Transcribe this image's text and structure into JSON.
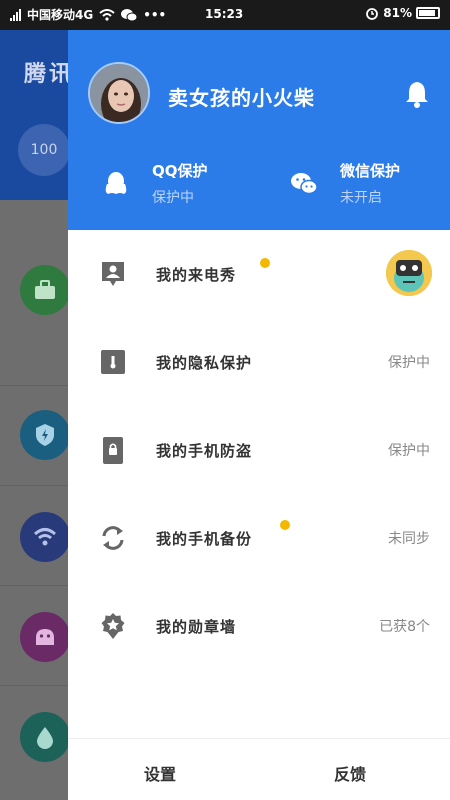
{
  "status_bar": {
    "carrier": "中国移动4G",
    "dots": "•••",
    "time": "15:23",
    "battery": "81%"
  },
  "background_app": {
    "title": "腾讯",
    "score": "100"
  },
  "drawer": {
    "user": {
      "name": "卖女孩的小火柴"
    },
    "protections": [
      {
        "label": "QQ保护",
        "status": "保护中"
      },
      {
        "label": "微信保护",
        "status": "未开启"
      }
    ],
    "menu": [
      {
        "label": "我的来电秀",
        "status": ""
      },
      {
        "label": "我的隐私保护",
        "status": "保护中"
      },
      {
        "label": "我的手机防盗",
        "status": "保护中"
      },
      {
        "label": "我的手机备份",
        "status": "未同步"
      },
      {
        "label": "我的勋章墙",
        "status": "已获8个"
      }
    ],
    "footer": {
      "settings": "设置",
      "feedback": "反馈"
    }
  },
  "colors": {
    "primary": "#2b7be8",
    "badge_dot": "#f5b800",
    "icon_gray": "#666666",
    "status_gray": "#888888"
  }
}
